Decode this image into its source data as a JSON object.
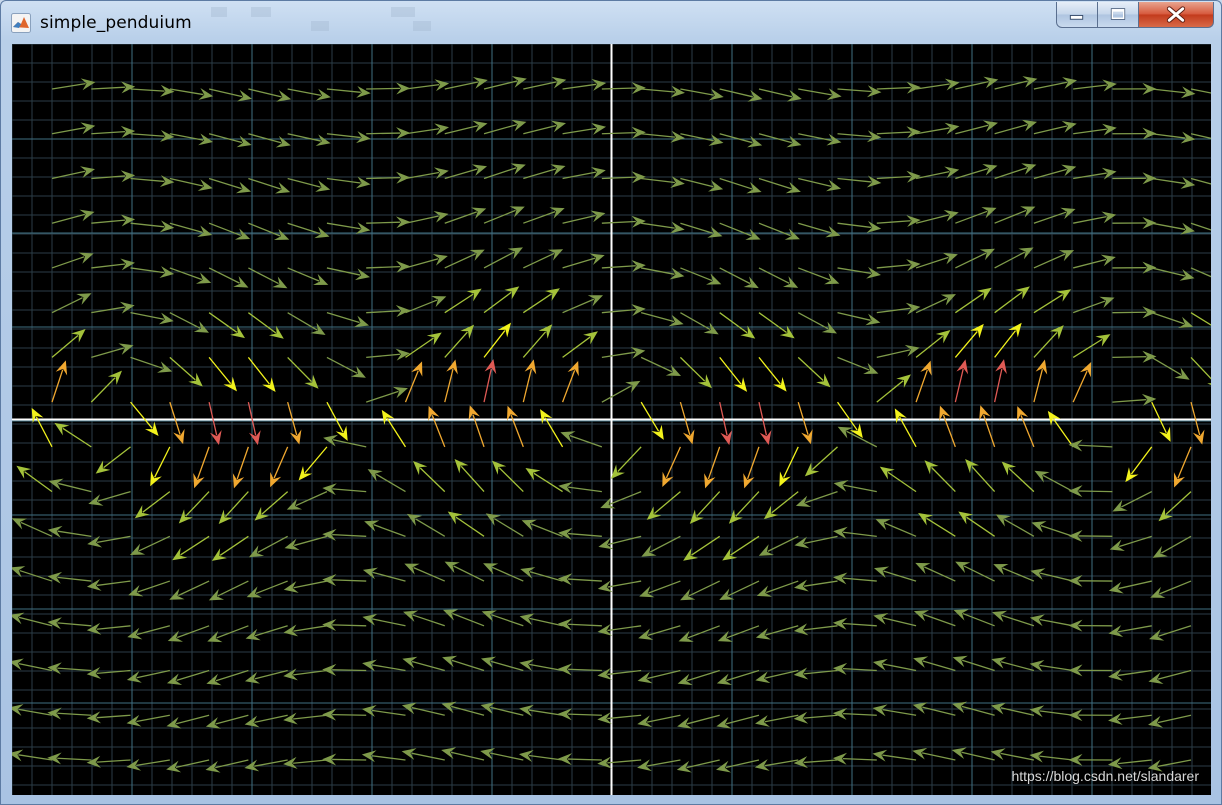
{
  "window": {
    "title": "simple_penduium",
    "app_icon": "matlab-icon",
    "controls": [
      "minimize-icon",
      "maximize-icon",
      "close-icon"
    ]
  },
  "plot": {
    "background": "#000000",
    "minor_grid_color": "#2b3d47",
    "major_grid_color": "#3f6f82",
    "axis_color": "#ffffff",
    "colors": {
      "low": "#7e9a4a",
      "mid_low": "#a4c23a",
      "mid": "#f2f21c",
      "mid_high": "#f0a830",
      "high": "#e05a55"
    }
  },
  "chart_data": {
    "type": "quiver",
    "title": "",
    "xlabel": "",
    "ylabel": "",
    "system": "simple pendulum phase field: dx/dt = y, dy/dt = -sin(x)",
    "xlim": [
      -7.5,
      7.5
    ],
    "ylim": [
      -4.7,
      4.7
    ],
    "grid": true,
    "colormap": "arrow color by speed: olive (slow) → yellow → orange → red (fast)"
  },
  "watermark": {
    "text": "https://blog.csdn.net/slandarer"
  }
}
